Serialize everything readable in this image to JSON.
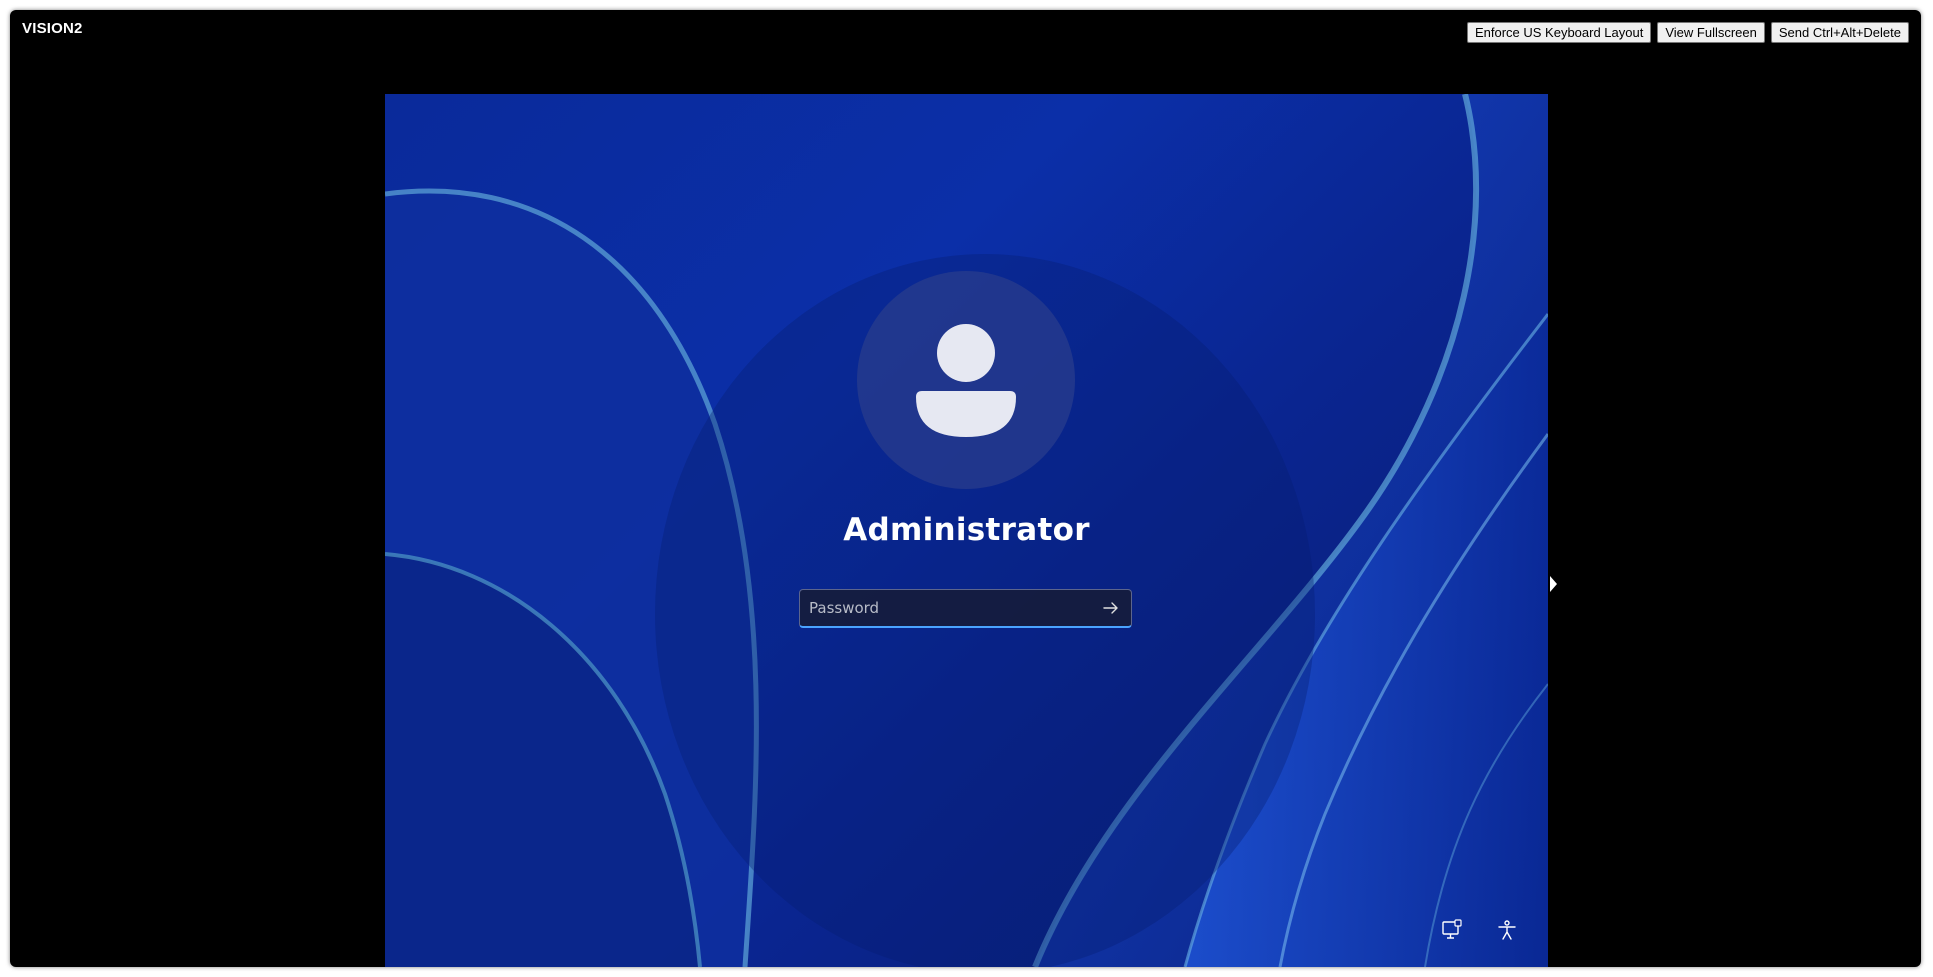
{
  "app": {
    "title": "VISION2"
  },
  "toolbar": {
    "enforce_keyboard_label": "Enforce US Keyboard Layout",
    "fullscreen_label": "View Fullscreen",
    "ctrl_alt_del_label": "Send Ctrl+Alt+Delete"
  },
  "login": {
    "username": "Administrator",
    "password_placeholder": "Password",
    "password_value": ""
  },
  "icons": {
    "avatar": "user-silhouette-icon",
    "submit": "arrow-right-icon",
    "network": "network-display-icon",
    "accessibility": "accessibility-icon"
  },
  "colors": {
    "window_bg": "#000000",
    "wallpaper": "#0b2fa8",
    "focus_accent": "#4aa3ff"
  }
}
